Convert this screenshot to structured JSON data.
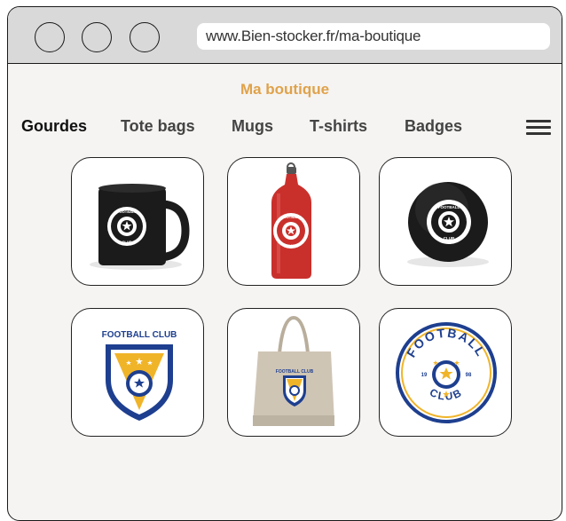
{
  "browser": {
    "url": "www.Bien-stocker.fr/ma-boutique"
  },
  "page": {
    "title": "Ma boutique"
  },
  "nav": {
    "items": [
      {
        "label": "Gourdes",
        "active": true
      },
      {
        "label": "Tote bags",
        "active": false
      },
      {
        "label": "Mugs",
        "active": false
      },
      {
        "label": "T-shirts",
        "active": false
      },
      {
        "label": "Badges",
        "active": false
      }
    ]
  },
  "products": {
    "badge_text_top": "FOOTBALL",
    "badge_text_bottom": "CLUB",
    "logo_header": "FOOTBALL CLUB",
    "year_left": "19",
    "year_right": "98",
    "colors": {
      "navy": "#1e3f8f",
      "gold": "#f0b429",
      "bottle_red": "#c9302c",
      "mug_black": "#1b1b1b",
      "bag_beige": "#cfc5b5"
    }
  }
}
